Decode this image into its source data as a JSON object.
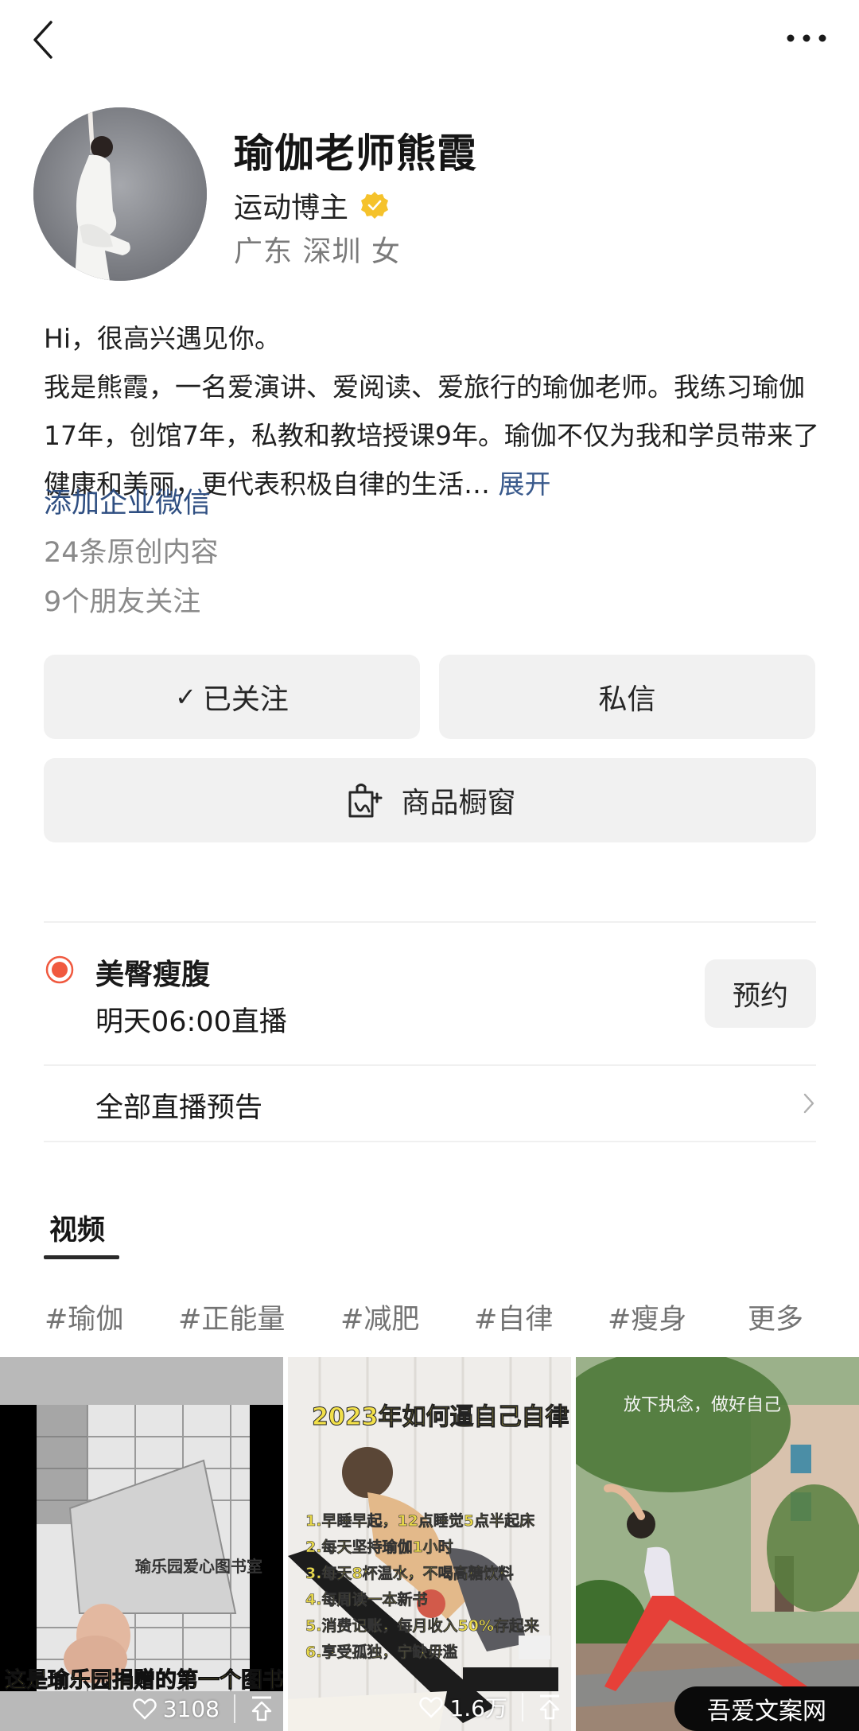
{
  "topbar": {
    "back_icon": "chevron-left-icon",
    "more_icon": "more-horizontal-icon"
  },
  "profile": {
    "name": "瑜伽老师熊霞",
    "role": "运动博主",
    "verified_icon": "verified-badge-icon",
    "verified_color": "#F5C22B",
    "location": "广东 深圳 女"
  },
  "bio": {
    "line1": "Hi，很高兴遇见你。",
    "body": "我是熊霞，一名爱演讲、爱阅读、爱旅行的瑜伽老师。我练习瑜伽17年，创馆7年，私教和教培授课9年。瑜伽不仅为我和学员带来了健康和美丽，更代表积极自律的生活…",
    "expand_label": "展开"
  },
  "links": {
    "wechat": "添加企业微信",
    "original_count": "24条原创内容",
    "friends_following": "9个朋友关注"
  },
  "actions": {
    "follow_check": "✓",
    "follow_label": "已关注",
    "message_label": "私信",
    "shop_label": "商品橱窗",
    "shop_icon": "shopping-bag-icon"
  },
  "live": {
    "dot_color": "#F0593F",
    "title": "美臀瘦腹",
    "time": "明天06:00直播",
    "reserve_label": "预约",
    "all_label": "全部直播预告"
  },
  "tabs": {
    "video_label": "视频"
  },
  "tags": [
    "#瑜伽",
    "#正能量",
    "#减肥",
    "#自律",
    "#瘦身",
    "更多"
  ],
  "videos": [
    {
      "caption": "这是瑜乐园捐赠的第一个图书室",
      "likes": "3108"
    },
    {
      "caption": "2023年如何逼自己自律",
      "list": [
        "1.早睡早起，12点睡觉5点半起床",
        "2.每天坚持瑜伽1小时",
        "3.每天8杯温水，不喝高糖饮料",
        "4.每周读一本新书",
        "5.消费记账，每月收入50%存起来",
        "6.享受孤独，宁缺毋滥"
      ],
      "likes": "1.6万"
    },
    {
      "caption": "放下执念，做好自己",
      "likes": ""
    }
  ],
  "watermark": "吾爱文案网"
}
